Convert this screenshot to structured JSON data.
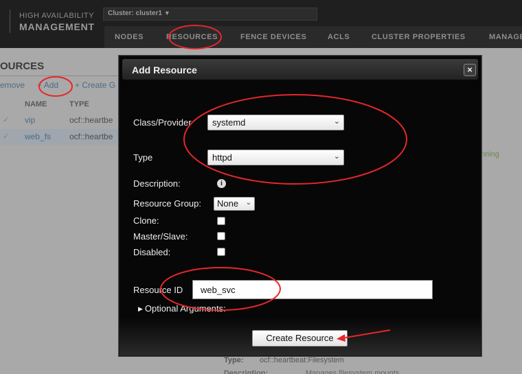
{
  "app": {
    "brand_line1": "HIGH AVAILABILITY",
    "brand_line2": "MANAGEMENT",
    "cluster_selector": "Cluster: cluster1",
    "nav": [
      "NODES",
      "RESOURCES",
      "FENCE DEVICES",
      "ACLS",
      "CLUSTER PROPERTIES",
      "MANAGE"
    ]
  },
  "resources_page": {
    "title": "OURCES",
    "actions": {
      "remove": "emove",
      "add": "Add",
      "create_group": "Create G"
    },
    "columns": {
      "name": "NAME",
      "type": "TYPE"
    },
    "rows": [
      {
        "check": "✓",
        "name": "vip",
        "type": "ocf::heartbe"
      },
      {
        "check": "✓",
        "name": "web_fs",
        "type": "ocf::heartbe"
      }
    ],
    "status_fragment": "nning",
    "details": {
      "type_label": "Type:",
      "type_value": "ocf::heartbeat:Filesystem",
      "description_label": "Description:",
      "description_value": "Manages filesystem mounts"
    }
  },
  "modal": {
    "title": "Add Resource",
    "close_label": "×",
    "class_provider_label": "Class/Provider",
    "class_provider_value": "systemd",
    "type_label": "Type",
    "type_value": "httpd",
    "description_label": "Description:",
    "info_icon": "i",
    "resource_group_label": "Resource Group:",
    "resource_group_value": "None",
    "clone_label": "Clone:",
    "clone_checked": false,
    "master_slave_label": "Master/Slave:",
    "master_slave_checked": false,
    "disabled_label": "Disabled:",
    "disabled_checked": false,
    "resource_id_label": "Resource ID",
    "resource_id_value": "web_svc",
    "optional_arguments_label": "Optional Arguments:",
    "create_button_label": "Create Resource"
  },
  "annotation_color": "#e8262a"
}
